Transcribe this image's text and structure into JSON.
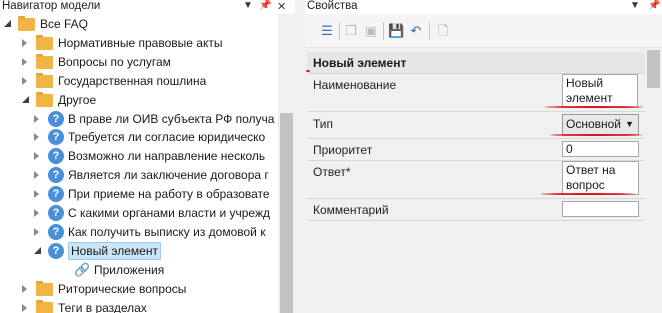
{
  "left_panel": {
    "title": "Навигатор модели",
    "tree": [
      {
        "label": "Все FAQ",
        "level": 1,
        "type": "folder",
        "expanded": true
      },
      {
        "label": "Нормативные правовые акты",
        "level": 2,
        "type": "folder",
        "expanded": false
      },
      {
        "label": "Вопросы по услугам",
        "level": 2,
        "type": "folder",
        "expanded": false
      },
      {
        "label": "Государственная пошлина",
        "level": 2,
        "type": "folder",
        "expanded": false
      },
      {
        "label": "Другое",
        "level": 2,
        "type": "folder",
        "expanded": true
      },
      {
        "label": "В праве ли ОИВ субъекта РФ получа",
        "level": 3,
        "type": "question"
      },
      {
        "label": "Требуется ли согласие юридическо",
        "level": 3,
        "type": "question"
      },
      {
        "label": "Возможно ли направление несколь",
        "level": 3,
        "type": "question"
      },
      {
        "label": "Является ли заключение договора г",
        "level": 3,
        "type": "question"
      },
      {
        "label": "При приеме на работу в образовате",
        "level": 3,
        "type": "question"
      },
      {
        "label": "С какими органами власти и учрежд",
        "level": 3,
        "type": "question"
      },
      {
        "label": "Как получить выписку из домовой к",
        "level": 3,
        "type": "question"
      },
      {
        "label": "Новый элемент",
        "level": 3,
        "type": "question",
        "expanded": true,
        "selected": true
      },
      {
        "label": "Приложения",
        "level": 4,
        "type": "link"
      },
      {
        "label": "Риторические вопросы",
        "level": 2,
        "type": "folder",
        "expanded": false
      },
      {
        "label": "Теги в разделах",
        "level": 2,
        "type": "folder",
        "expanded": false
      }
    ]
  },
  "right_panel": {
    "title": "Свойства",
    "group_title": "Новый элемент",
    "props": {
      "name_label": "Наименование",
      "name_value": "Новый элемент",
      "type_label": "Тип",
      "type_value": "Основной",
      "priority_label": "Приоритет",
      "priority_value": "0",
      "answer_label": "Ответ*",
      "answer_value": "Ответ на вопрос",
      "comment_label": "Комментарий",
      "comment_value": ""
    },
    "toolbar_icons": [
      "property-list-icon",
      "copy-icon",
      "paste-icon",
      "save-icon",
      "undo-icon",
      "clear-icon"
    ]
  },
  "colors": {
    "folder": "#f0b545",
    "question": "#4a90d9",
    "selection": "#cce4f7",
    "annotation": "#e0141e"
  }
}
